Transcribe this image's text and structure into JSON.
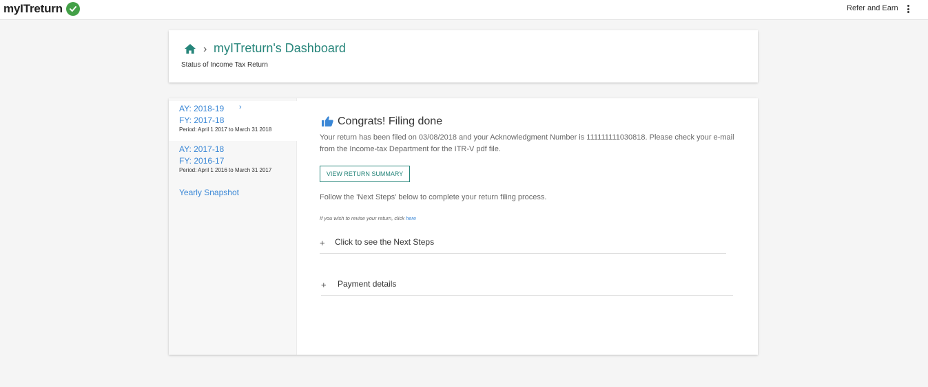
{
  "app": {
    "logo_text": "myITreturn",
    "brand_color": "#26857a",
    "link_color": "#3a87d6",
    "check_color": "#43a047"
  },
  "topbar": {
    "refer_label": "Refer and Earn",
    "menu_icon": "kebab-menu-icon"
  },
  "header": {
    "home_icon": "home-icon",
    "title": "myITreturn's Dashboard",
    "subtitle": "Status of Income Tax Return"
  },
  "sidebar": {
    "items": [
      {
        "ay": "AY: 2018-19",
        "fy": "FY: 2017-18",
        "period": "Period: April 1 2017 to March 31 2018",
        "active": true
      },
      {
        "ay": "AY: 2017-18",
        "fy": "FY: 2016-17",
        "period": "Period: April 1 2016 to March 31 2017",
        "active": false
      }
    ],
    "snapshot_label": "Yearly Snapshot"
  },
  "main": {
    "heading": "Congrats! Filing done",
    "message": "Your return has been filed on 03/08/2018 and your Acknowledgment Number is 111111111030818. Please check your e-mail from the Income-tax Department for the ITR-V pdf file.",
    "summary_button": "VIEW RETURN SUMMARY",
    "follow_text": "Follow the 'Next Steps' below to complete your return filing process.",
    "revise_text": "If you wish to revise your return, click",
    "revise_link": "here",
    "accordions": [
      {
        "icon": "+",
        "label": "Click to see the Next Steps"
      },
      {
        "icon": "+",
        "label": "Payment details"
      }
    ]
  }
}
